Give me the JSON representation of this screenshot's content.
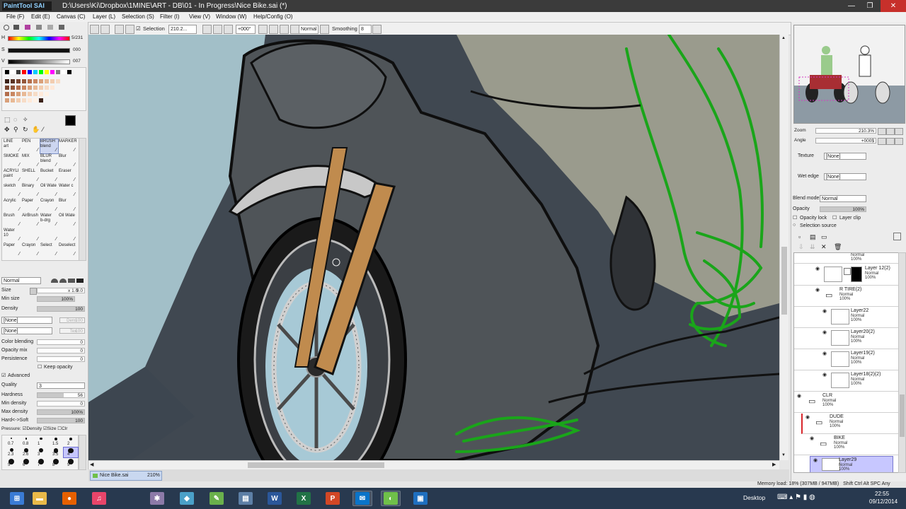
{
  "window": {
    "app_name": "PaintTool SAI",
    "title": "D:\\Users\\Ki\\Dropbox\\1MINE\\ART - DB\\01 - In Progress\\Nice Bike.sai (*)"
  },
  "menu": [
    {
      "label": "File (F)"
    },
    {
      "label": "Edit (E)"
    },
    {
      "label": "Canvas (C)"
    },
    {
      "label": "Layer (L)"
    },
    {
      "label": "Selection (S)"
    },
    {
      "label": "Filter (I)"
    },
    {
      "label": "View (V)"
    },
    {
      "label": "Window (W)"
    },
    {
      "label": "Help/Config (O)"
    }
  ],
  "toolbar": {
    "selection_label": "Selection",
    "zoom_value": "210.2...",
    "rotation_value": "+000°",
    "mode_value": "Normal",
    "smoothing_label": "Smoothing",
    "smoothing_value": "8"
  },
  "color": {
    "h_label": "H",
    "h_value": "5/231",
    "s_label": "S",
    "s_value": "000",
    "v_label": "V",
    "v_value": "007",
    "primary": "#000000",
    "secondary": "#ffffff"
  },
  "tools": [
    {
      "label": "LINE",
      "sub": "art"
    },
    {
      "label": "PEN",
      "sub": ""
    },
    {
      "label": "BRUSH",
      "sub": "blend"
    },
    {
      "label": "MARKER",
      "sub": ""
    },
    {
      "label": "SMOKE",
      "sub": ""
    },
    {
      "label": "MIX",
      "sub": ""
    },
    {
      "label": "BLUR",
      "sub": "blend"
    },
    {
      "label": "Blur",
      "sub": ""
    },
    {
      "label": "ACRYLI",
      "sub": "paint"
    },
    {
      "label": "SHELL",
      "sub": ""
    },
    {
      "label": "Bucket",
      "sub": ""
    },
    {
      "label": "Eraser",
      "sub": ""
    },
    {
      "label": "sketch",
      "sub": ""
    },
    {
      "label": "Binary",
      "sub": ""
    },
    {
      "label": "Oil Wate",
      "sub": ""
    },
    {
      "label": "Water c",
      "sub": ""
    },
    {
      "label": "Acrylic",
      "sub": ""
    },
    {
      "label": "Paper",
      "sub": ""
    },
    {
      "label": "Crayon",
      "sub": ""
    },
    {
      "label": "Blur",
      "sub": ""
    },
    {
      "label": "Brush",
      "sub": ""
    },
    {
      "label": "AirBrush",
      "sub": ""
    },
    {
      "label": "Water",
      "sub": "b-drg"
    },
    {
      "label": "Oil Wate",
      "sub": ""
    },
    {
      "label": "Water",
      "sub": "10"
    },
    {
      "label": "",
      "sub": ""
    },
    {
      "label": "",
      "sub": ""
    },
    {
      "label": "",
      "sub": ""
    },
    {
      "label": "Paper",
      "sub": ""
    },
    {
      "label": "Crayon",
      "sub": ""
    },
    {
      "label": "Select",
      "sub": ""
    },
    {
      "label": "Deselect",
      "sub": ""
    }
  ],
  "brush": {
    "blend_mode": "Normal",
    "size_label": "Size",
    "size_mult": "x 1.0",
    "size_value": "9.0",
    "minsize_label": "Min size",
    "minsize_value": "100%",
    "minsize_level": 1.0,
    "density_label": "Density",
    "density_value": "100",
    "density_level": 1.0,
    "shape": "[None]",
    "texture": "[None]",
    "dens_label": "Dens",
    "dens_value": "100",
    "tex_label": "Tex",
    "tex_value": "100",
    "color_blending_label": "Color blending",
    "color_blending_value": "0",
    "opacity_mix_label": "Opacity mix",
    "opacity_mix_value": "0",
    "persistence_label": "Persistence",
    "persistence_value": "0",
    "keep_opacity_label": "Keep opacity",
    "advanced_label": "Advanced",
    "quality_label": "Quality",
    "quality_value": "3",
    "hardness_label": "Hardness",
    "hardness_value": "56",
    "hardness_level": 0.56,
    "mindensity_label": "Min density",
    "mindensity_value": "0",
    "maxdensity_label": "Max density",
    "maxdensity_value": "100%",
    "maxdensity_level": 1.0,
    "hardsoft_label": "Hard<->Soft",
    "hardsoft_value": "100",
    "hardsoft_level": 1.0,
    "pressure_label": "Pressure:",
    "pressure_density": "Density",
    "pressure_size": "Size",
    "pressure_clr": "Clr",
    "dot_sizes": [
      "0.7",
      "0.8",
      "1",
      "1.5",
      "2",
      "2.3",
      "2.6",
      "3",
      "3.5",
      "4",
      "5",
      "6",
      "7",
      "8",
      "9"
    ]
  },
  "navigator": {
    "zoom_label": "Zoom",
    "zoom_value": "210.3%",
    "angle_label": "Angle",
    "angle_value": "+000$"
  },
  "layer_props": {
    "texture_label": "Texture",
    "texture_value": "[None]",
    "wetedge_label": "Wet edge",
    "wetedge_value": "[None]",
    "blend_label": "Blend mode",
    "blend_value": "Normal",
    "opacity_label": "Opacity",
    "opacity_value": "100%",
    "opacity_level": 1.0,
    "opacity_lock": "Opacity lock",
    "layer_clip": "Layer clip",
    "selection_source": "Selection source"
  },
  "layers": [
    {
      "name": "",
      "mode": "Normal",
      "opacity": "100%"
    },
    {
      "name": "Layer 12(2)",
      "mode": "Normal",
      "opacity": "100%"
    },
    {
      "name": "R TIRE(2)",
      "mode": "Normal",
      "opacity": "100%"
    },
    {
      "name": "Layer22",
      "mode": "Normal",
      "opacity": "100%"
    },
    {
      "name": "Layer20(2)",
      "mode": "Normal",
      "opacity": "100%"
    },
    {
      "name": "Layer19(2)",
      "mode": "Normal",
      "opacity": "100%"
    },
    {
      "name": "Layer18(2)(2)",
      "mode": "Normal",
      "opacity": "100%"
    },
    {
      "name": "CLR",
      "mode": "Normal",
      "opacity": "100%"
    },
    {
      "name": "DUDE",
      "mode": "Normal",
      "opacity": "100%"
    },
    {
      "name": "BIKE",
      "mode": "Normal",
      "opacity": "100%"
    },
    {
      "name": "Layer29",
      "mode": "Normal",
      "opacity": "100%"
    }
  ],
  "document_tab": {
    "name": "Nice Bike.sai",
    "zoom": "210%"
  },
  "status": {
    "memory": "Memory load: 18% (307MB / 947MB)",
    "keys": "Shift Ctrl Alt SPC Any"
  },
  "taskbar": {
    "desktop_label": "Desktop",
    "time": "22:55",
    "date": "09/12/2014",
    "apps": [
      {
        "name": "Start",
        "color": "#3a7bd5",
        "glyph": "⊞"
      },
      {
        "name": "File Explorer",
        "color": "#e9b949",
        "glyph": "▬"
      },
      {
        "name": "Firefox",
        "color": "#e66000",
        "glyph": "●"
      },
      {
        "name": "iTunes",
        "color": "#e8456a",
        "glyph": "♫"
      },
      {
        "name": "Tool",
        "color": "#8c7aa8",
        "glyph": "✱"
      },
      {
        "name": "Sketch",
        "color": "#4aa0c8",
        "glyph": "◆"
      },
      {
        "name": "Notepad++",
        "color": "#6ab04c",
        "glyph": "✎"
      },
      {
        "name": "Document",
        "color": "#5d7fa6",
        "glyph": "▤"
      },
      {
        "name": "Word",
        "color": "#2b579a",
        "glyph": "W"
      },
      {
        "name": "Excel",
        "color": "#217346",
        "glyph": "X"
      },
      {
        "name": "PowerPoint",
        "color": "#d24726",
        "glyph": "P"
      },
      {
        "name": "Mail",
        "color": "#0a74c9",
        "glyph": "✉"
      },
      {
        "name": "PaintTool SAI",
        "color": "#6fc04a",
        "glyph": "◐"
      },
      {
        "name": "Window",
        "color": "#1f6fbf",
        "glyph": "▣"
      }
    ]
  }
}
